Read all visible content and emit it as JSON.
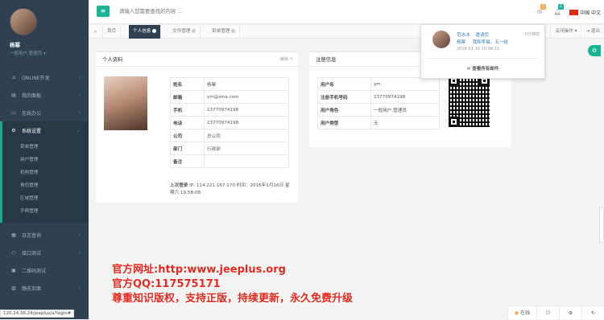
{
  "sidebar": {
    "user_name": "杨幂",
    "user_role": "一般用户,管理员",
    "items": [
      {
        "icon": "home-icon",
        "label": "ONLINE开发"
      },
      {
        "icon": "dashboard-icon",
        "label": "我的面板"
      },
      {
        "icon": "desktop-icon",
        "label": "在线办公"
      },
      {
        "icon": "gear-icon",
        "label": "系统设置"
      }
    ],
    "sub_items": [
      "菜单管理",
      "用户管理",
      "机构管理",
      "角色管理",
      "区域管理",
      "字典管理"
    ],
    "bottom_items": [
      {
        "icon": "calendar-icon",
        "label": "日志查询"
      },
      {
        "icon": "circle-icon",
        "label": "接口测试"
      },
      {
        "icon": "qrcode-icon",
        "label": "二维码测试"
      },
      {
        "icon": "paste-icon",
        "label": "静态页面"
      }
    ]
  },
  "topbar": {
    "search_placeholder": "请输入您需要查找的内容 …",
    "mail_count": "1",
    "notify_count": "0",
    "lang_label": "中国 中文"
  },
  "tabs": {
    "items": [
      "首页",
      "个人信息",
      "文件管理",
      "菜单管理"
    ],
    "active": "个人信息",
    "close_ops": "关闭操作",
    "logout": "退出"
  },
  "profile_panel": {
    "title": "个人资料",
    "edit": "编辑",
    "rows": [
      {
        "k": "姓名",
        "v": "杨幂"
      },
      {
        "k": "邮箱",
        "v": "ym@sina.com"
      },
      {
        "k": "手机",
        "v": "13770974198"
      },
      {
        "k": "电话",
        "v": "13770974198"
      },
      {
        "k": "公司",
        "v": "总公司"
      },
      {
        "k": "部门",
        "v": "行政部"
      },
      {
        "k": "备注",
        "v": ""
      }
    ],
    "last_login_label": "上次登录",
    "last_login_ip": "IP: 114.221.167.170",
    "last_login_time": "时间：2016年1月16日 星期六 19:58:08"
  },
  "register_panel": {
    "title": "注册信息",
    "rows": [
      {
        "k": "用户名",
        "v": "ym"
      },
      {
        "k": "注册手机号码",
        "v": "13770974198"
      },
      {
        "k": "用户角色",
        "v": "一般用户,管理员"
      },
      {
        "k": "用户类型",
        "v": "无"
      }
    ]
  },
  "dropdown": {
    "from": "范冰冰",
    "action": "邀请您",
    "time_ago": "0分钟前",
    "to": "杨幂",
    "message": "我和李晨，五一结",
    "date": "2016-01-16 20:08:11",
    "view_all": "查看所有邮件"
  },
  "watermark": {
    "line1": "官方网址:http:www.jeeplus.org",
    "line2": "官方QQ:117575171",
    "line3": "尊重知识版权，支持正版，持续更新，永久免费升级"
  },
  "status_url": "120.24.36.24/jeeplus/a?login#",
  "footer": {
    "online": "在线"
  },
  "colors": {
    "sidebar": "#2f4050",
    "accent": "#1ab394",
    "watermark": "#e8261a"
  }
}
